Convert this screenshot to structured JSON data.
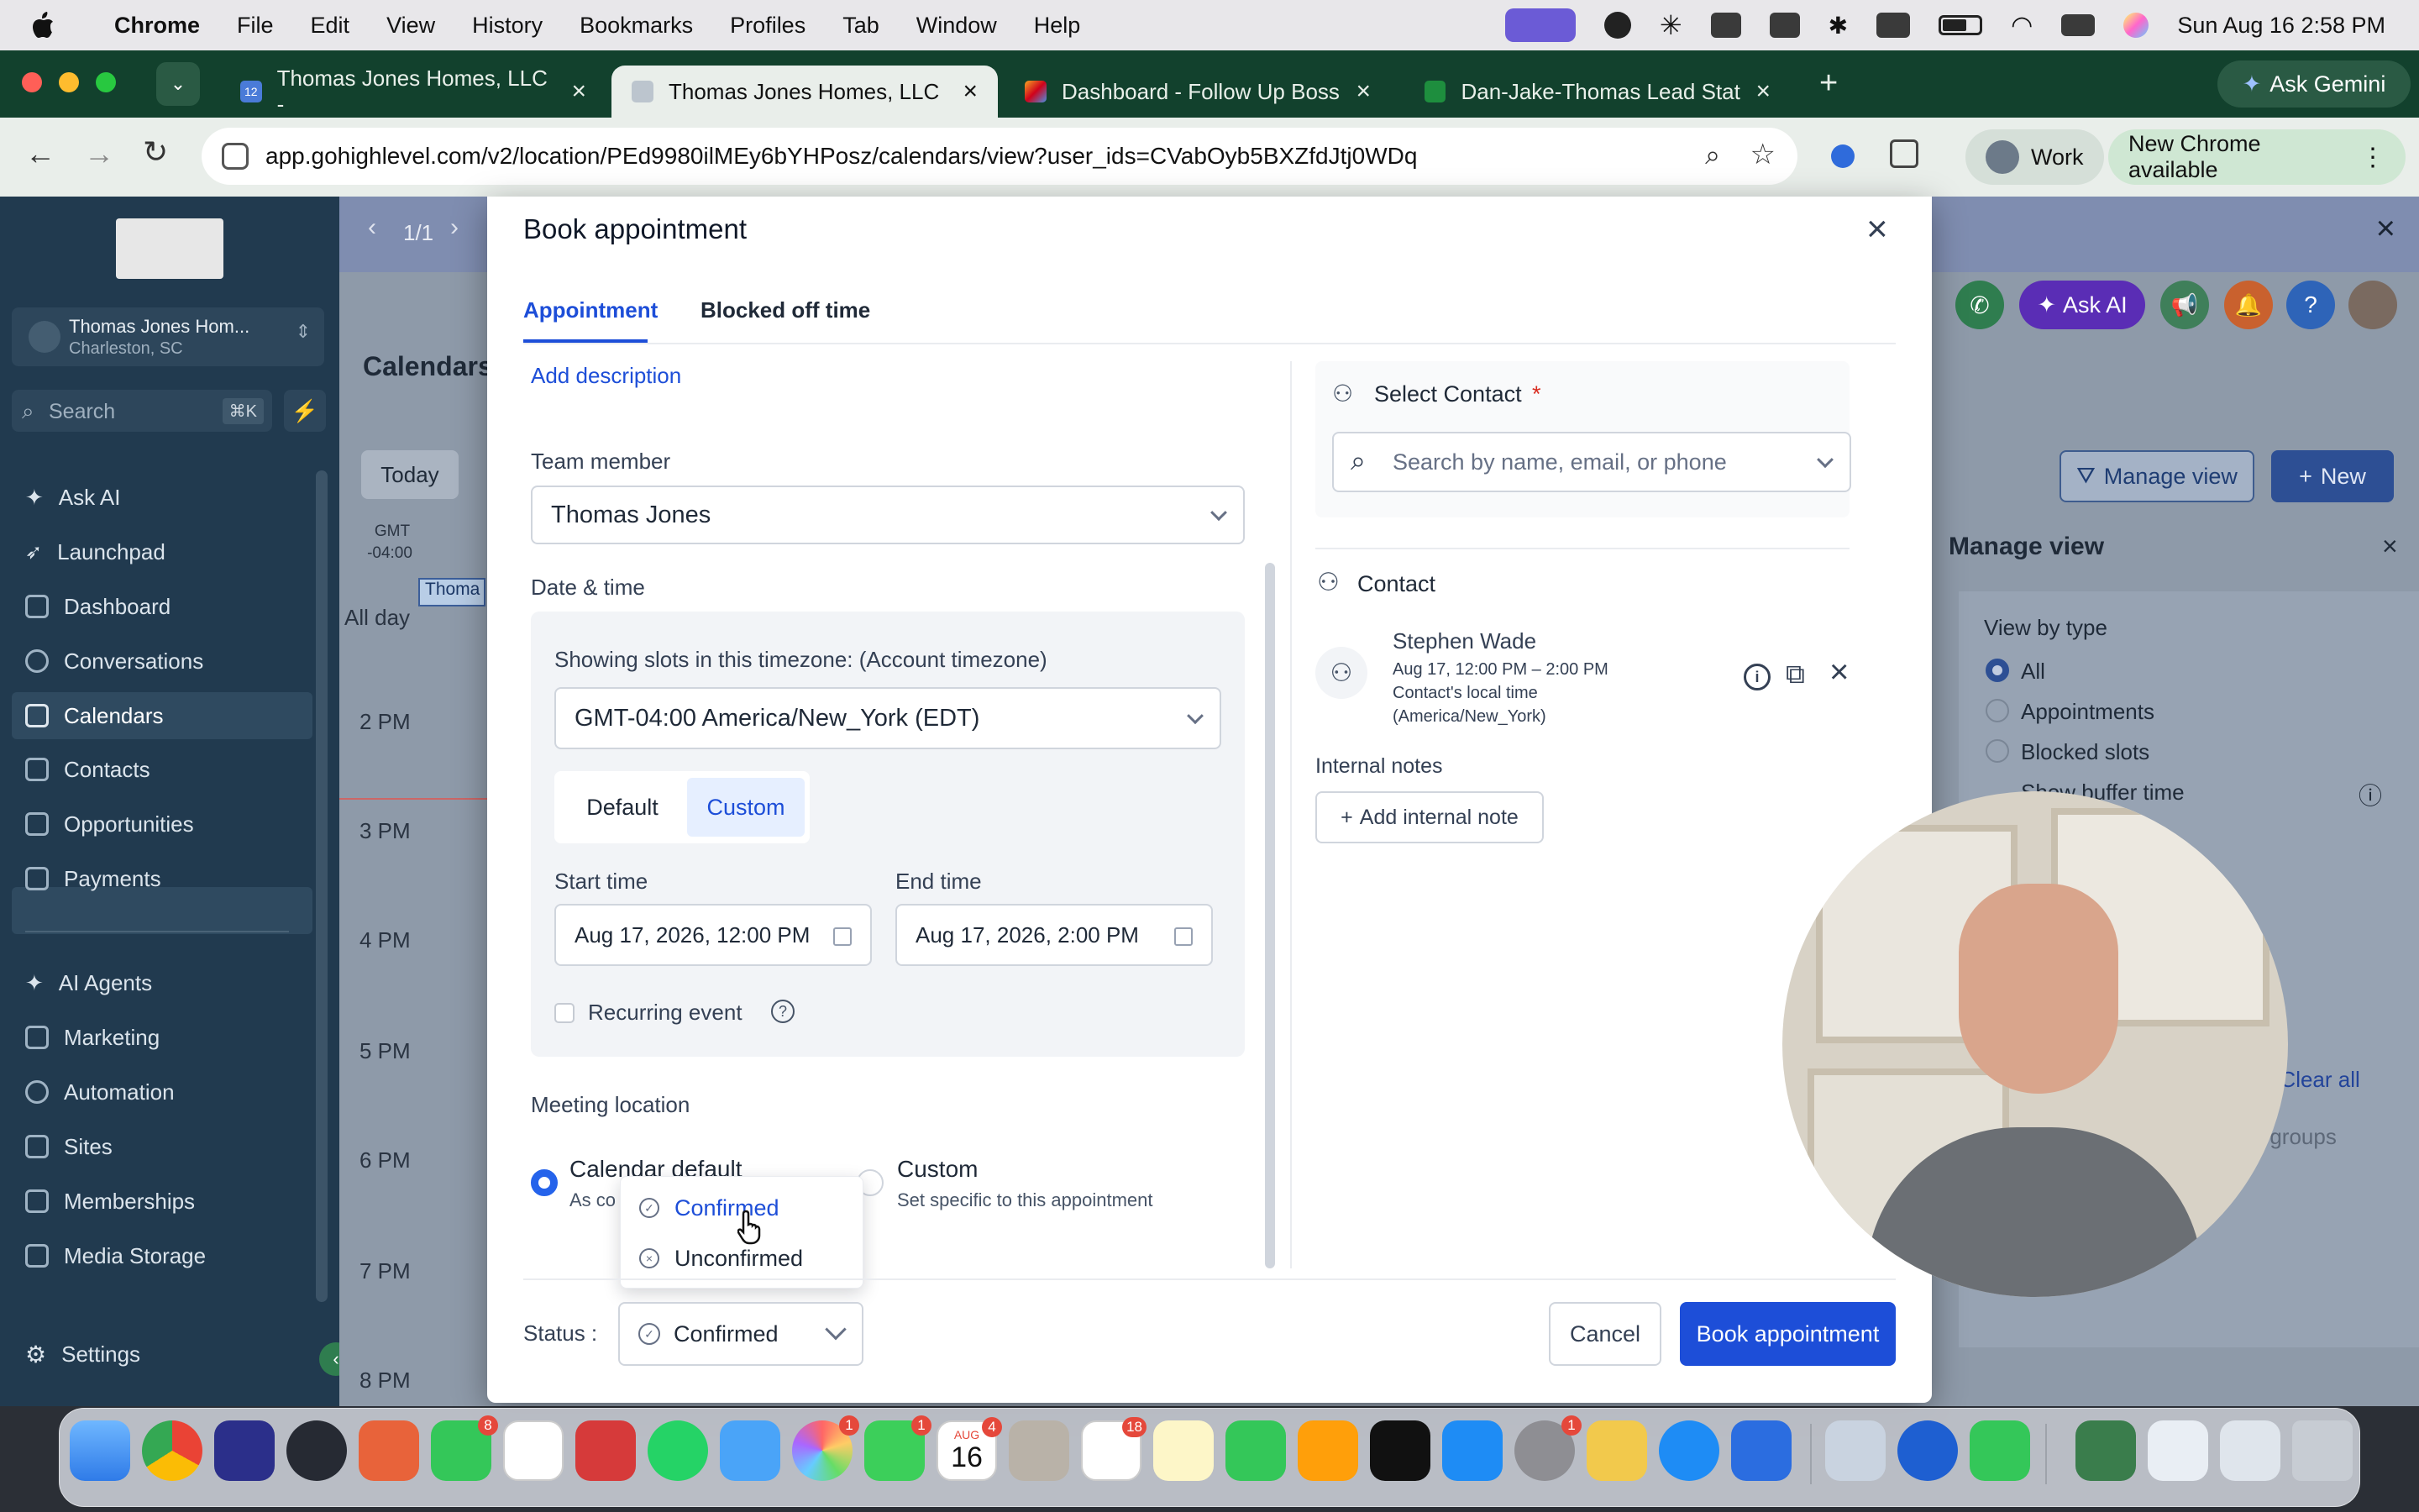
{
  "menubar": {
    "apple": "",
    "app": "Chrome",
    "items": [
      "File",
      "Edit",
      "View",
      "History",
      "Bookmarks",
      "Profiles",
      "Tab",
      "Window",
      "Help"
    ],
    "clock": "Sun Aug 16  2:58 PM"
  },
  "browser": {
    "tabs": [
      {
        "title": "Thomas Jones Homes, LLC -",
        "favicon_text": "12"
      },
      {
        "title": "Thomas Jones Homes, LLC"
      },
      {
        "title": "Dashboard - Follow Up Boss"
      },
      {
        "title": "Dan-Jake-Thomas Lead Statu"
      }
    ],
    "ask_gemini": "Ask Gemini",
    "url": "app.gohighlevel.com/v2/location/PEd9980ilMEy6bYHPosz/calendars/view?user_ids=CVabOyb5BXZfdJtj0WDq",
    "profile": "Work",
    "update": "New Chrome available"
  },
  "app": {
    "account_name": "Thomas Jones Hom...",
    "account_location": "Charleston, SC",
    "search_placeholder": "Search",
    "search_shortcut": "⌘K",
    "nav": [
      "Ask AI",
      "Launchpad",
      "Dashboard",
      "Conversations",
      "Calendars",
      "Contacts",
      "Opportunities",
      "Payments"
    ],
    "nav2": [
      "AI Agents",
      "Marketing",
      "Automation",
      "Sites",
      "Memberships",
      "Media Storage"
    ],
    "settings": "Settings",
    "pager": "1/1",
    "page_title": "Calendars",
    "today": "Today",
    "gmt_line1": "GMT",
    "gmt_line2": "-04:00",
    "all_day": "All day",
    "event_chip": "Thoma",
    "times": [
      "2 PM",
      "3 PM",
      "4 PM",
      "5 PM",
      "6 PM",
      "7 PM",
      "8 PM"
    ],
    "ask_ai": "Ask AI",
    "manage_view_btn": "Manage view",
    "new_btn": "New",
    "manage_view": {
      "title": "Manage view",
      "view_by_type": "View by type",
      "options": [
        "All",
        "Appointments",
        "Blocked slots"
      ],
      "buffer": "Show buffer time",
      "clear_all": "Clear all",
      "groups_placeholder": "or groups"
    }
  },
  "modal": {
    "title": "Book appointment",
    "tabs": [
      "Appointment",
      "Blocked off time"
    ],
    "add_description": "Add description",
    "team_member_label": "Team member",
    "team_member_value": "Thomas Jones",
    "date_time_label": "Date & time",
    "timezone_label": "Showing slots in this timezone: (Account timezone)",
    "timezone_value": "GMT-04:00 America/New_York (EDT)",
    "slot_modes": [
      "Default",
      "Custom"
    ],
    "start_label": "Start time",
    "start_value": "Aug 17, 2026, 12:00 PM",
    "end_label": "End time",
    "end_value": "Aug 17, 2026, 2:00 PM",
    "recurring": "Recurring event",
    "meeting_location_label": "Meeting location",
    "loc_default": "Calendar default",
    "loc_default_sub": "As co",
    "loc_custom": "Custom",
    "loc_custom_sub": "Set specific to this appointment",
    "status_label": "Status :",
    "status_value": "Confirmed",
    "status_options": [
      "Confirmed",
      "Unconfirmed"
    ],
    "cancel": "Cancel",
    "book": "Book appointment",
    "select_contact_label": "Select Contact",
    "required_mark": "*",
    "contact_search_placeholder": "Search by name, email, or phone",
    "contact_section": "Contact",
    "contact_name": "Stephen Wade",
    "contact_time": "Aug 17, 12:00 PM – 2:00 PM",
    "contact_local": "Contact's local time",
    "contact_tz": "(America/New_York)",
    "internal_notes": "Internal notes",
    "add_note": "Add internal note"
  },
  "dock": {
    "badges": {
      "messages": "8",
      "photos": "1",
      "facetime": "1",
      "calendar": "4",
      "reminders": "18",
      "settings": "1"
    },
    "calendar_day": "16",
    "calendar_month": "AUG"
  },
  "colors": {
    "primary": "#1d4ed8",
    "sidebar": "#213a4f",
    "chrome_tabbar": "#12412d"
  }
}
